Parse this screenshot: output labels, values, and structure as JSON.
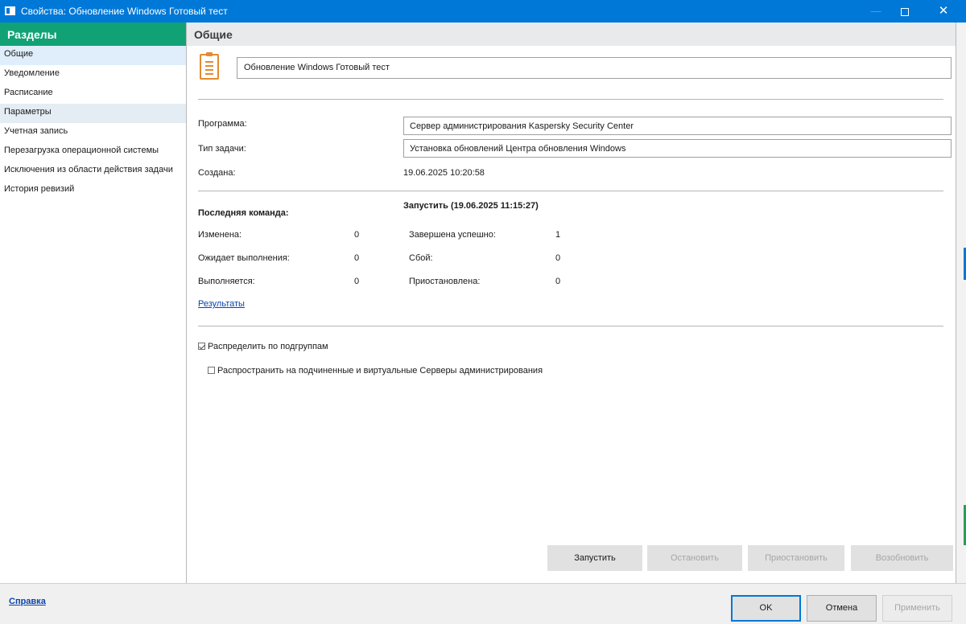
{
  "window": {
    "title": "Свойства: Обновление Windows Готовый тест",
    "minimize": "—",
    "close": "✕"
  },
  "sidebar": {
    "header": "Разделы",
    "items": [
      {
        "label": "Общие"
      },
      {
        "label": "Уведомление"
      },
      {
        "label": "Расписание"
      },
      {
        "label": "Параметры"
      },
      {
        "label": "Учетная запись"
      },
      {
        "label": "Перезагрузка операционной системы"
      },
      {
        "label": "Исключения из области действия задачи"
      },
      {
        "label": "История ревизий"
      }
    ]
  },
  "main": {
    "header": "Общие",
    "task_name": "Обновление Windows Готовый тест",
    "program_label": "Программа:",
    "program_value": "Сервер администрирования Kaspersky Security Center",
    "task_type_label": "Тип задачи:",
    "task_type_value": "Установка обновлений Центра обновления Windows",
    "created_label": "Создана:",
    "created_value": "19.06.2025 10:20:58",
    "last_command_label": "Последняя команда:",
    "last_command_value": "Запустить (19.06.2025 11:15:27)",
    "stats": {
      "changed_label": "Изменена:",
      "changed_value": "0",
      "pending_label": "Ожидает выполнения:",
      "pending_value": "0",
      "running_label": "Выполняется:",
      "running_value": "0",
      "succeeded_label": "Завершена успешно:",
      "succeeded_value": "1",
      "failed_label": "Сбой:",
      "failed_value": "0",
      "paused_label": "Приостановлена:",
      "paused_value": "0"
    },
    "results_link": "Результаты",
    "distribute_subgroups": {
      "label": "Распределить по подгруппам",
      "checked": true
    },
    "spread_servers": {
      "label": "Распространить на подчиненные и виртуальные Серверы администрирования",
      "checked": false
    },
    "buttons": {
      "start": "Запустить",
      "stop": "Остановить",
      "pause": "Приостановить",
      "resume": "Возобновить"
    }
  },
  "footer": {
    "help": "Справка",
    "ok": "OK",
    "cancel": "Отмена",
    "apply": "Применить"
  }
}
